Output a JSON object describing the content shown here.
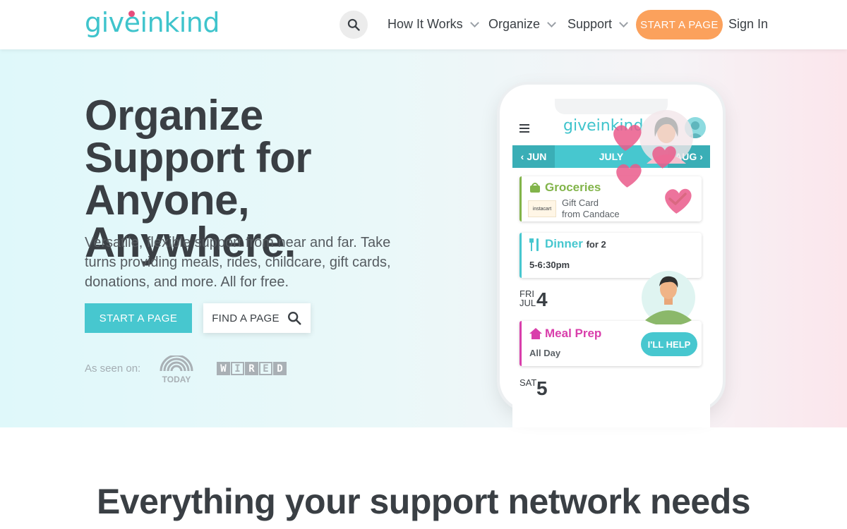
{
  "header": {
    "logo_text": "giveinkind",
    "nav": [
      {
        "label": "How It Works"
      },
      {
        "label": "Organize"
      },
      {
        "label": "Support"
      }
    ],
    "start_label": "START A PAGE",
    "signin_label": "Sign In"
  },
  "hero": {
    "title": "Organize Support for Anyone, Anywhere.",
    "description": "Versatile, flexible support from near and far. Take turns providing meals, rides, childcare, gift cards, donations, and more. All for free.",
    "start_label": "START A PAGE",
    "find_label": "FIND A PAGE",
    "seen_on_label": "As seen on:",
    "press": [
      {
        "name": "today-logo",
        "text": "TODAY"
      },
      {
        "name": "wired-logo",
        "letters": [
          "W",
          "I",
          "R",
          "E",
          "D"
        ]
      }
    ]
  },
  "phone": {
    "app_logo": "giveinkind",
    "months": {
      "prev": "JUN",
      "current": "JULY",
      "next": "AUG"
    },
    "cards": [
      {
        "title": "Groceries",
        "sub1": "Gift Card",
        "sub2": "from Candace",
        "badge": "instacart",
        "color": "#82b44a",
        "icon": "basket-icon",
        "done": true
      },
      {
        "title": "Dinner",
        "title_suffix": "for 2",
        "sub1": "5-6:30pm",
        "color": "#47c7cf",
        "icon": "utensils-icon"
      },
      {
        "title": "Meal Prep",
        "sub1": "All Day",
        "color": "#d93eab",
        "icon": "house-icon",
        "action": "I'LL HELP"
      }
    ],
    "days": [
      {
        "dow": "FRI",
        "month": "JUL",
        "num": "4"
      },
      {
        "dow": "SAT",
        "num": "5"
      }
    ]
  },
  "colors": {
    "teal": "#47c7cf",
    "orange": "#fba15c",
    "pink": "#ea5b8b",
    "green": "#82b44a",
    "magenta": "#d93eab",
    "text": "#3a3f44"
  },
  "section2": {
    "title": "Everything your support network needs"
  }
}
